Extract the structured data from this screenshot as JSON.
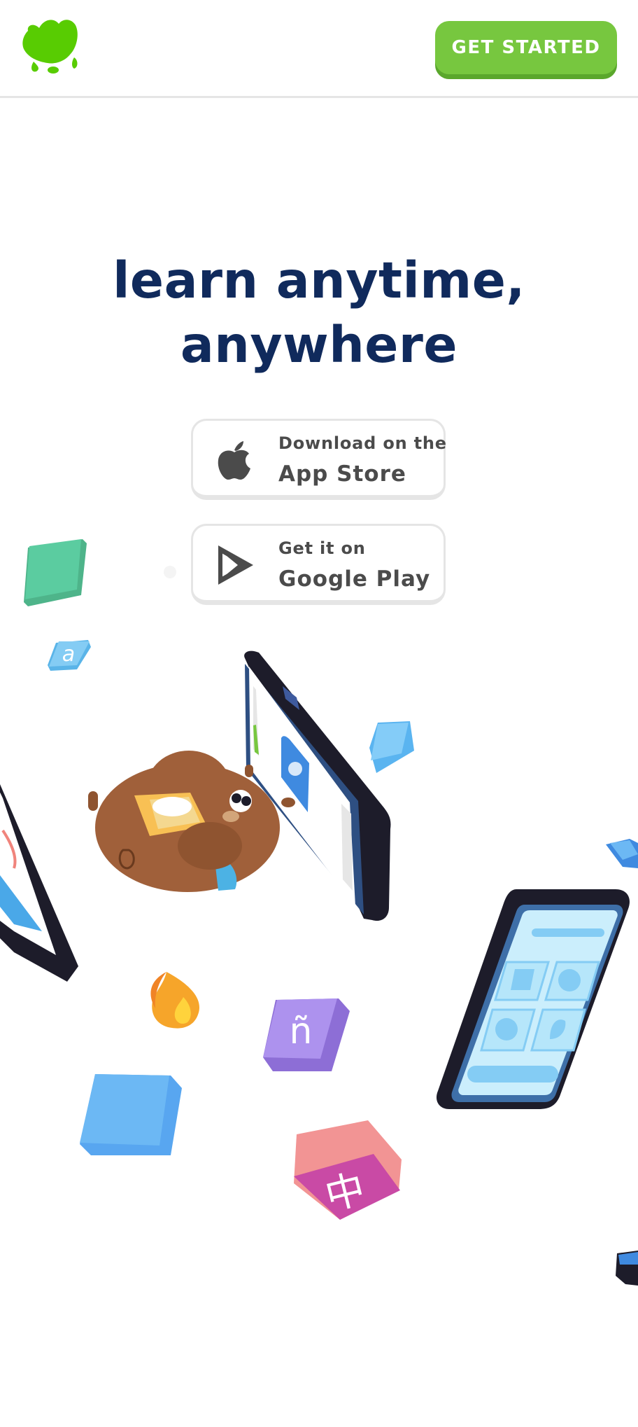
{
  "header": {
    "logo_icon": "duo-owl-logo-icon",
    "brand_color": "#77c73f",
    "cta_label": "GET STARTED"
  },
  "hero": {
    "title_line1": "learn anytime,",
    "title_line2": "anywhere",
    "title_color": "#102a5c"
  },
  "stores": {
    "app_store": {
      "icon": "apple-icon",
      "small_text": "Download on the",
      "big_text": "App Store"
    },
    "google_play": {
      "icon": "google-play-icon",
      "small_text": "Get it on",
      "big_text": "Google Play"
    }
  },
  "illustration": {
    "letter_a": "a",
    "letter_n_tilde": "ñ",
    "letter_chinese": "中"
  }
}
